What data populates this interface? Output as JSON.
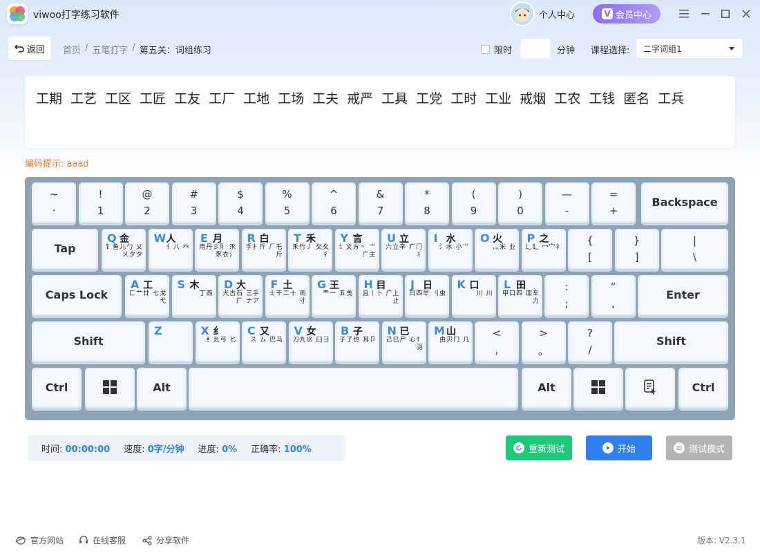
{
  "app": {
    "title": "viwoo打字练习软件",
    "personal_center": "个人中心",
    "vip_label": "会员中心",
    "vip_badge": "V"
  },
  "toolbar": {
    "back_label": "返回",
    "breadcrumb": [
      "首页",
      "/",
      "五笔打字",
      "/",
      "第五关：词组练习"
    ],
    "limit_label": "限时",
    "minutes_value": "",
    "minutes_label": "分钟",
    "course_label": "课程选择:",
    "course_value": "二字词组1"
  },
  "practice": {
    "words": [
      "工期",
      "工艺",
      "工区",
      "工匠",
      "工友",
      "工厂",
      "工地",
      "工场",
      "工夫",
      "戒严",
      "工具",
      "工党",
      "工时",
      "工业",
      "戒烟",
      "工农",
      "工钱",
      "匿名",
      "工兵"
    ],
    "hint": "编码提示: aaad"
  },
  "keyboard": {
    "row1": [
      {
        "top": "~",
        "bottom": "·"
      },
      {
        "top": "!",
        "bottom": "1"
      },
      {
        "top": "@",
        "bottom": "2"
      },
      {
        "top": "#",
        "bottom": "3"
      },
      {
        "top": "$",
        "bottom": "4"
      },
      {
        "top": "%",
        "bottom": "5"
      },
      {
        "top": "^",
        "bottom": "6"
      },
      {
        "top": "&",
        "bottom": "7"
      },
      {
        "top": "*",
        "bottom": "8"
      },
      {
        "top": "(",
        "bottom": "9"
      },
      {
        "top": ")",
        "bottom": "0"
      },
      {
        "top": "—",
        "bottom": "-"
      },
      {
        "top": "=",
        "bottom": "+"
      }
    ],
    "backspace": "Backspace",
    "tab": "Tap",
    "row2": [
      {
        "letter": "Q",
        "main": "金",
        "sub": "钅鱼儿勹 乂ㄨ夕夕"
      },
      {
        "letter": "W",
        "main": "人",
        "sub": "亻八 癶"
      },
      {
        "letter": "E",
        "main": "月",
        "sub": "用丹彡⺼ 乑豕衣氵"
      },
      {
        "letter": "R",
        "main": "白",
        "sub": "手扌斤 ⺁乇斤"
      },
      {
        "letter": "T",
        "main": "禾",
        "sub": "禾竹丿 攵夂彳"
      },
      {
        "letter": "Y",
        "main": "言",
        "sub": "讠文方丶 亠广主"
      },
      {
        "letter": "U",
        "main": "立",
        "sub": "六立辛 疒门丬"
      },
      {
        "letter": "I",
        "main": "水",
        "sub": "氵水 小⺌"
      },
      {
        "letter": "O",
        "main": "火",
        "sub": "灬米 业"
      },
      {
        "letter": "P",
        "main": "之",
        "sub": "辶廴 冖宀礻"
      }
    ],
    "row2_sym": [
      {
        "top": "{",
        "bottom": "["
      },
      {
        "top": "}",
        "bottom": "]"
      },
      {
        "top": "|",
        "bottom": "\\"
      }
    ],
    "caps": "Caps Lock",
    "row3": [
      {
        "letter": "A",
        "main": "工",
        "sub": "匚艹廿 七戈弋"
      },
      {
        "letter": "S",
        "main": "木",
        "sub": "丁西"
      },
      {
        "letter": "D",
        "main": "大",
        "sub": "犬古石 三手厂 ナア"
      },
      {
        "letter": "F",
        "main": "土",
        "sub": "士干二十 雨寸"
      },
      {
        "letter": "G",
        "main": "王",
        "sub": "龶一 五戋"
      },
      {
        "letter": "H",
        "main": "目",
        "sub": "且丨卜 广上止"
      },
      {
        "letter": "J",
        "main": "日",
        "sub": "曰四早 刂虫"
      },
      {
        "letter": "K",
        "main": "口",
        "sub": "川 川"
      },
      {
        "letter": "L",
        "main": "田",
        "sub": "甲口四 皿车力"
      }
    ],
    "row3_sym": [
      {
        "top": ":",
        "bottom": ";"
      },
      {
        "top": "“",
        "bottom": ","
      }
    ],
    "enter": "Enter",
    "shift_left": "Shift",
    "row4": [
      {
        "letter": "Z",
        "main": "",
        "sub": ""
      },
      {
        "letter": "X",
        "main": "纟",
        "sub": "纟幺弓 匕"
      },
      {
        "letter": "C",
        "main": "又",
        "sub": "ス ム 巴马"
      },
      {
        "letter": "V",
        "main": "女",
        "sub": "刀九巛 臼彐"
      },
      {
        "letter": "B",
        "main": "子",
        "sub": "子了也 耳卩"
      },
      {
        "letter": "N",
        "main": "已",
        "sub": "己巳尸 心忄羽"
      },
      {
        "letter": "M",
        "main": "山",
        "sub": "由贝冂 几"
      }
    ],
    "row4_sym": [
      {
        "top": "<",
        "bottom": ","
      },
      {
        "top": ">",
        "bottom": "。"
      },
      {
        "top": "?",
        "bottom": "/"
      }
    ],
    "shift_right": "Shift",
    "ctrl_left": "Ctrl",
    "alt_left": "Alt",
    "alt_right": "Alt",
    "ctrl_right": "Ctrl"
  },
  "stats": {
    "time_label": "时间:",
    "time_value": "00:00:00",
    "speed_label": "速度:",
    "speed_value": "0字/分钟",
    "progress_label": "进度:",
    "progress_value": "0%",
    "accuracy_label": "正确率:",
    "accuracy_value": "100%"
  },
  "actions": {
    "retest": "重新测试",
    "start": "开始",
    "test_mode": "测试模式"
  },
  "footer": {
    "website": "官方网站",
    "service": "在线客服",
    "share": "分享软件",
    "version": "版本: V2.3.1"
  },
  "colors": {
    "accent": "#2e7ef0",
    "retest": "#1fc97a",
    "start": "#2e7ef0",
    "test_mode": "#b5b5b5",
    "hint": "#f0822b",
    "vip": "#8c6bf2",
    "keyboard_bg": "#8ea3b3"
  }
}
